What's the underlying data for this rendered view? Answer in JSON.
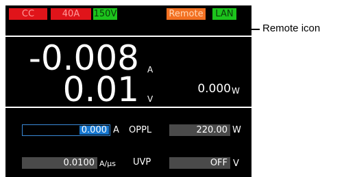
{
  "status_bar": {
    "mode": "CC",
    "current_range": "40A",
    "voltage_range": "150V",
    "remote": "Remote",
    "lan": "LAN"
  },
  "measurements": {
    "current_value": "-0.008",
    "current_unit": "A",
    "voltage_value": "0.01",
    "voltage_unit": "V",
    "power_value": "0.000",
    "power_unit": "W"
  },
  "settings": {
    "current_setpoint": "0.000",
    "current_unit": "A",
    "slew_rate": "0.0100",
    "slew_unit": "A/µs",
    "oppl_label": "OPPL",
    "oppl_value": "220.00",
    "oppl_unit": "W",
    "uvp_label": "UVP",
    "uvp_value": "OFF",
    "uvp_unit": "V"
  },
  "annotation": {
    "callout_label": "Remote icon"
  },
  "colors": {
    "red_badge": "#e0141a",
    "green_badge": "#1cc41c",
    "orange_badge": "#f37021",
    "selection_blue": "#1677d0"
  }
}
